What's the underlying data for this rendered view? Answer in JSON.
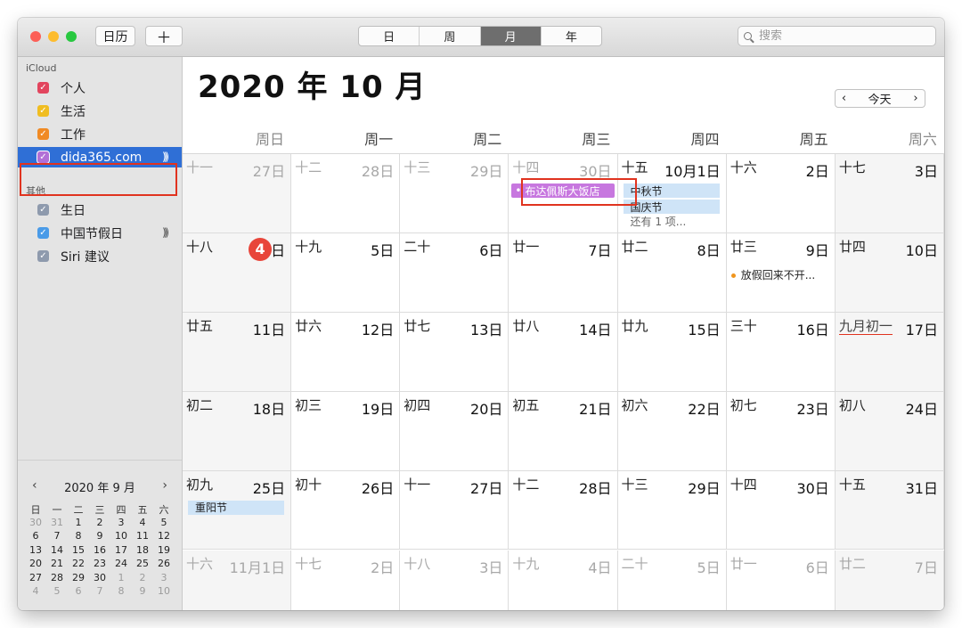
{
  "toolbar": {
    "calendars_button": "日历",
    "add_button": "＋",
    "view_tabs": [
      "日",
      "周",
      "月",
      "年"
    ],
    "active_tab": 2,
    "search_placeholder": "搜索"
  },
  "sidebar": {
    "icloud_label": "iCloud",
    "icloud_items": [
      {
        "label": "个人",
        "color": "#e2455e",
        "checked": true
      },
      {
        "label": "生活",
        "color": "#f0bd21",
        "checked": true
      },
      {
        "label": "工作",
        "color": "#f08a24",
        "checked": true
      },
      {
        "label": "dida365.com",
        "color": "#b26fd6",
        "checked": true,
        "selected": true,
        "subscribed": true
      }
    ],
    "other_label": "其他",
    "other_items": [
      {
        "label": "生日",
        "color": "#8e9aad",
        "checked": true
      },
      {
        "label": "中国节假日",
        "color": "#4a9be8",
        "checked": true,
        "subscribed": true
      },
      {
        "label": "Siri 建议",
        "color": "#8e9aad",
        "checked": true
      }
    ]
  },
  "mini_calendar": {
    "title": "2020 年 9 月",
    "prev": "‹",
    "next": "›",
    "weekdays": [
      "日",
      "一",
      "二",
      "三",
      "四",
      "五",
      "六"
    ],
    "weeks": [
      [
        [
          "30",
          true
        ],
        [
          "31",
          true
        ],
        [
          "1",
          false
        ],
        [
          "2",
          false
        ],
        [
          "3",
          false
        ],
        [
          "4",
          false
        ],
        [
          "5",
          false
        ]
      ],
      [
        [
          "6",
          false
        ],
        [
          "7",
          false
        ],
        [
          "8",
          false
        ],
        [
          "9",
          false
        ],
        [
          "10",
          false
        ],
        [
          "11",
          false
        ],
        [
          "12",
          false
        ]
      ],
      [
        [
          "13",
          false
        ],
        [
          "14",
          false
        ],
        [
          "15",
          false
        ],
        [
          "16",
          false
        ],
        [
          "17",
          false
        ],
        [
          "18",
          false
        ],
        [
          "19",
          false
        ]
      ],
      [
        [
          "20",
          false
        ],
        [
          "21",
          false
        ],
        [
          "22",
          false
        ],
        [
          "23",
          false
        ],
        [
          "24",
          false
        ],
        [
          "25",
          false
        ],
        [
          "26",
          false
        ]
      ],
      [
        [
          "27",
          false
        ],
        [
          "28",
          false
        ],
        [
          "29",
          false
        ],
        [
          "30",
          false
        ],
        [
          "1",
          true
        ],
        [
          "2",
          true
        ],
        [
          "3",
          true
        ]
      ],
      [
        [
          "4",
          true
        ],
        [
          "5",
          true
        ],
        [
          "6",
          true
        ],
        [
          "7",
          true
        ],
        [
          "8",
          true
        ],
        [
          "9",
          true
        ],
        [
          "10",
          true
        ]
      ]
    ]
  },
  "main": {
    "title": "2020 年 10 月",
    "today_button": "今天",
    "prev_button": "‹",
    "next_button": "›",
    "weekdays": [
      "周日",
      "周一",
      "周二",
      "周三",
      "周四",
      "周五",
      "周六"
    ],
    "weeks": [
      [
        {
          "lunar": "十一",
          "day": "27日",
          "muted": true
        },
        {
          "lunar": "十二",
          "day": "28日",
          "muted": true
        },
        {
          "lunar": "十三",
          "day": "29日",
          "muted": true
        },
        {
          "lunar": "十四",
          "day": "30日",
          "muted": true,
          "events": [
            {
              "title": "布达佩斯大饭店",
              "style": "purple"
            }
          ]
        },
        {
          "lunar": "十五",
          "day": "10月1日",
          "events": [
            {
              "title": "中秋节",
              "style": "blue"
            },
            {
              "title": "国庆节",
              "style": "blue"
            }
          ],
          "more": "还有 1 项..."
        },
        {
          "lunar": "十六",
          "day": "2日"
        },
        {
          "lunar": "十七",
          "day": "3日"
        }
      ],
      [
        {
          "lunar": "十八",
          "day": "日",
          "today": "4"
        },
        {
          "lunar": "十九",
          "day": "5日"
        },
        {
          "lunar": "二十",
          "day": "6日"
        },
        {
          "lunar": "廿一",
          "day": "7日"
        },
        {
          "lunar": "廿二",
          "day": "8日"
        },
        {
          "lunar": "廿三",
          "day": "9日",
          "dot_event": "放假回来不开..."
        },
        {
          "lunar": "廿四",
          "day": "10日"
        }
      ],
      [
        {
          "lunar": "廿五",
          "day": "11日"
        },
        {
          "lunar": "廿六",
          "day": "12日"
        },
        {
          "lunar": "廿七",
          "day": "13日"
        },
        {
          "lunar": "廿八",
          "day": "14日"
        },
        {
          "lunar": "廿九",
          "day": "15日"
        },
        {
          "lunar": "三十",
          "day": "16日"
        },
        {
          "lunar": "九月初一",
          "day": "17日",
          "festival": true
        }
      ],
      [
        {
          "lunar": "初二",
          "day": "18日"
        },
        {
          "lunar": "初三",
          "day": "19日"
        },
        {
          "lunar": "初四",
          "day": "20日"
        },
        {
          "lunar": "初五",
          "day": "21日"
        },
        {
          "lunar": "初六",
          "day": "22日"
        },
        {
          "lunar": "初七",
          "day": "23日"
        },
        {
          "lunar": "初八",
          "day": "24日"
        }
      ],
      [
        {
          "lunar": "初九",
          "day": "25日",
          "events": [
            {
              "title": "重阳节",
              "style": "blue"
            }
          ]
        },
        {
          "lunar": "初十",
          "day": "26日"
        },
        {
          "lunar": "十一",
          "day": "27日"
        },
        {
          "lunar": "十二",
          "day": "28日"
        },
        {
          "lunar": "十三",
          "day": "29日"
        },
        {
          "lunar": "十四",
          "day": "30日"
        },
        {
          "lunar": "十五",
          "day": "31日"
        }
      ],
      [
        {
          "lunar": "十六",
          "day": "11月1日",
          "muted": true
        },
        {
          "lunar": "十七",
          "day": "2日",
          "muted": true
        },
        {
          "lunar": "十八",
          "day": "3日",
          "muted": true
        },
        {
          "lunar": "十九",
          "day": "4日",
          "muted": true
        },
        {
          "lunar": "二十",
          "day": "5日",
          "muted": true
        },
        {
          "lunar": "廿一",
          "day": "6日",
          "muted": true
        },
        {
          "lunar": "廿二",
          "day": "7日",
          "muted": true
        }
      ]
    ]
  }
}
